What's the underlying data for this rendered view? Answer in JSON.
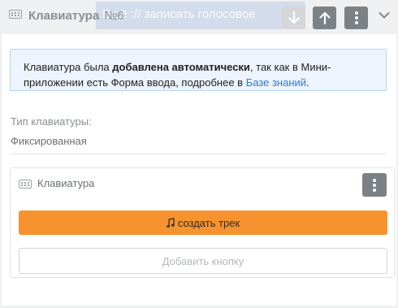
{
  "background": {
    "ghost_text": "Ещё :// записать голосовое"
  },
  "header": {
    "title": "Клавиатура",
    "number": "№6",
    "icons": {
      "keyboard": "keyboard-icon",
      "down": "arrow-down-icon",
      "up": "arrow-up-icon",
      "menu": "kebab-menu-icon",
      "collapse": "chevron-down-icon"
    }
  },
  "notice": {
    "text_before": "Клавиатура была ",
    "text_bold": "добавлена автоматически",
    "text_middle": ", так как в Мини-приложении есть Форма ввода, подробнее в ",
    "link": "Базе знаний",
    "text_end": "."
  },
  "keyboard_type": {
    "label": "Тип клавиатуры:",
    "value": "Фиксированная"
  },
  "keyboard_block": {
    "title": "Клавиатура",
    "button_label": "создать трек",
    "button_icon": "music-note-icon",
    "add_button_label": "Добавить кнопку"
  },
  "colors": {
    "accent": "#f7932e",
    "link": "#2f7bd6",
    "notice_bg": "#edf4fd",
    "notice_border": "#b7d3f3",
    "dark_button": "#7c8186"
  }
}
